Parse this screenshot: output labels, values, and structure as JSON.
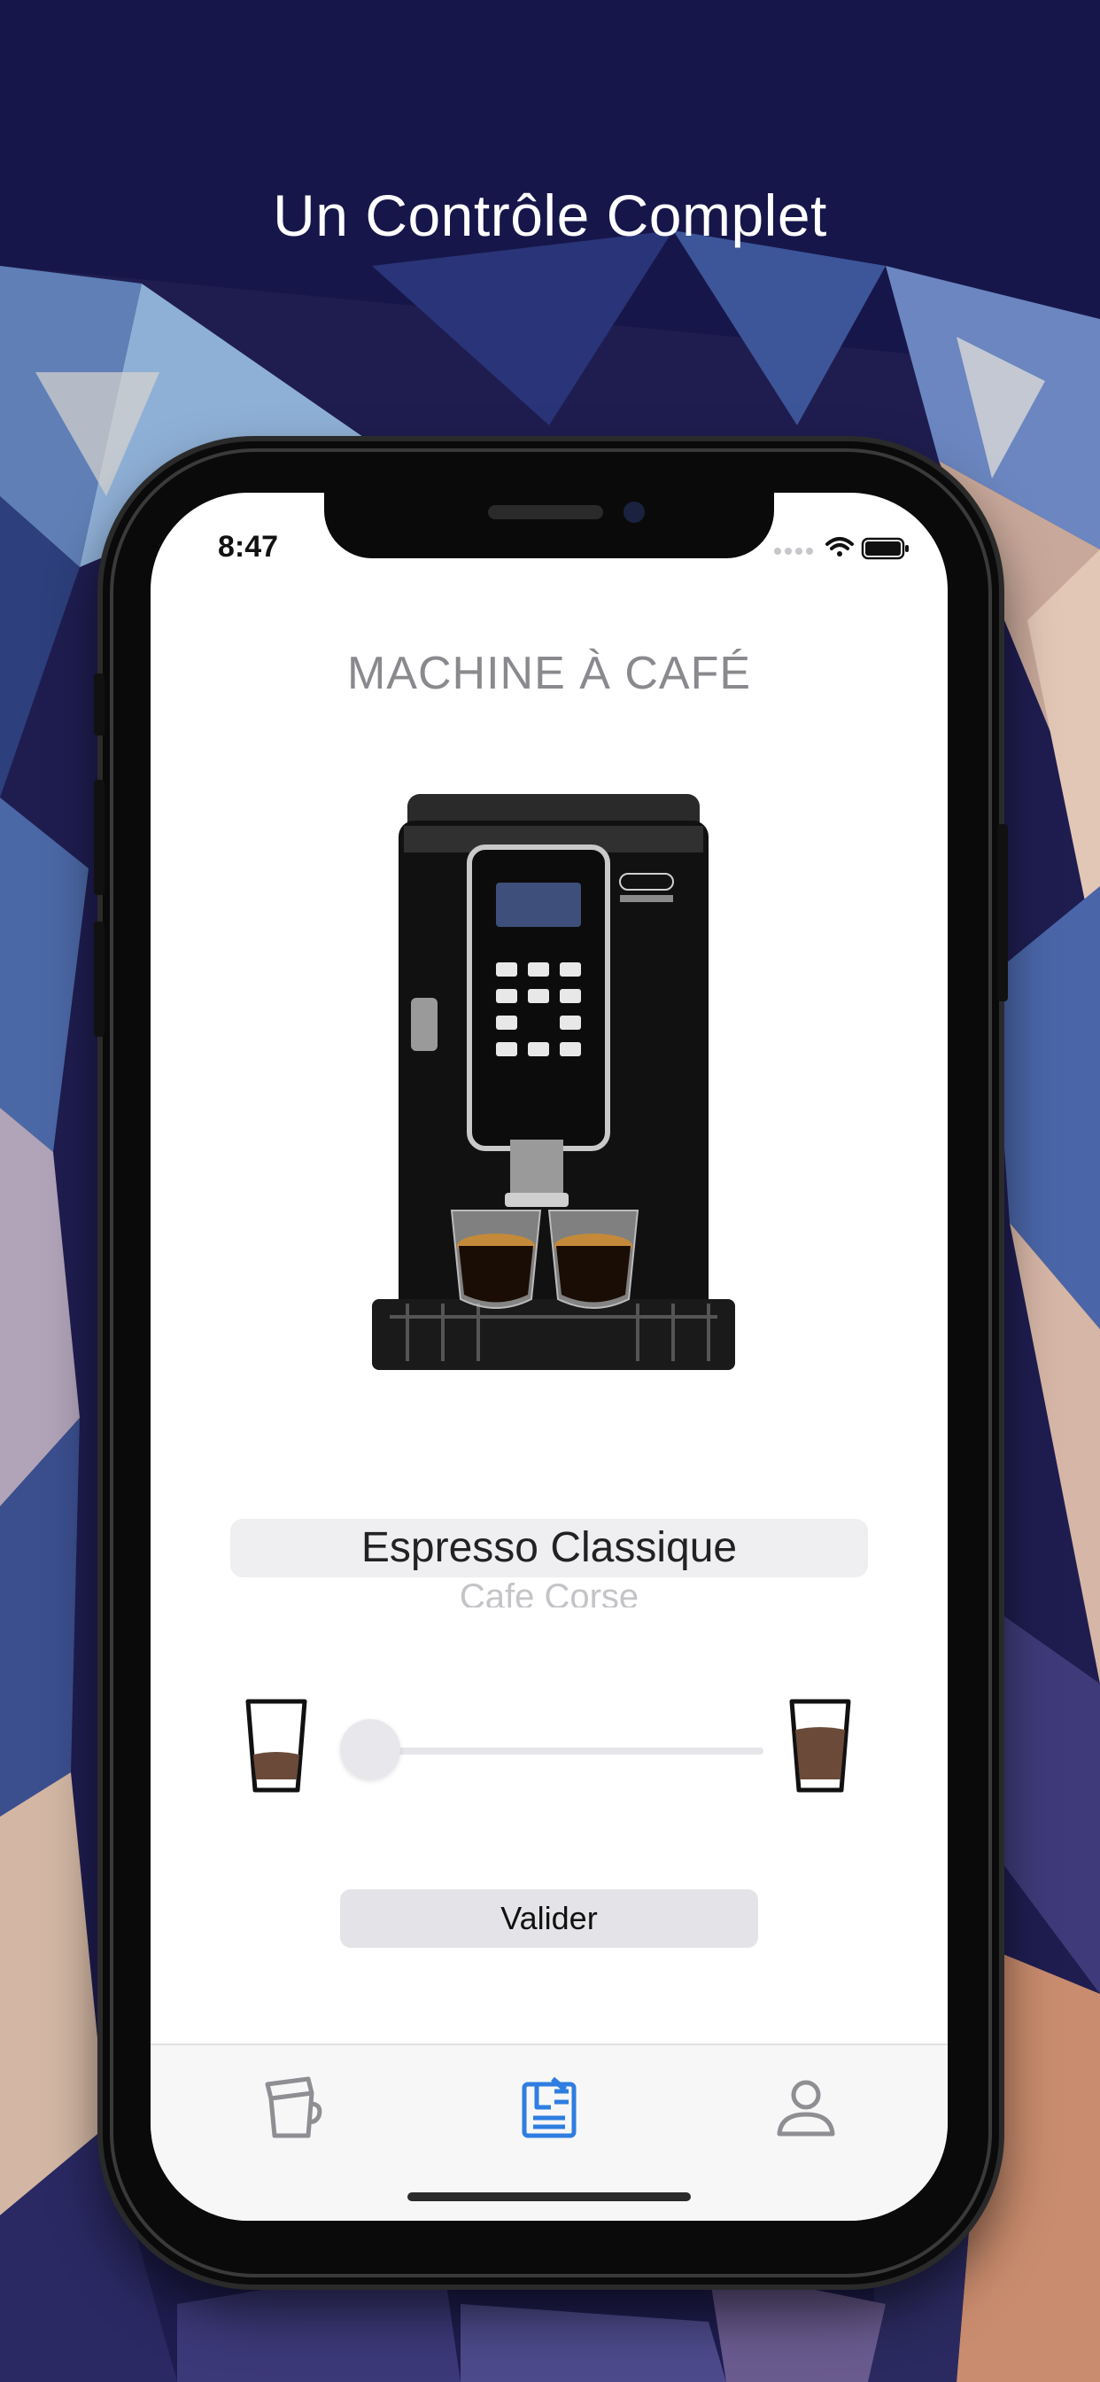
{
  "headline": "Un Contrôle Complet",
  "status_bar": {
    "time": "8:47"
  },
  "screen": {
    "title": "MACHINE À CAFÉ",
    "picker": {
      "selected": "Espresso Classique",
      "next": "Cafe Corse"
    },
    "size_slider": {
      "value": 0.0
    },
    "validate_label": "Valider"
  },
  "tab_bar": {
    "items": [
      {
        "icon": "cup-icon",
        "active": false
      },
      {
        "icon": "machine-settings-icon",
        "active": true
      },
      {
        "icon": "profile-icon",
        "active": false
      }
    ]
  },
  "colors": {
    "accent": "#2f7de1",
    "inactive": "#8e8e93",
    "background": "#1e1c4e"
  }
}
